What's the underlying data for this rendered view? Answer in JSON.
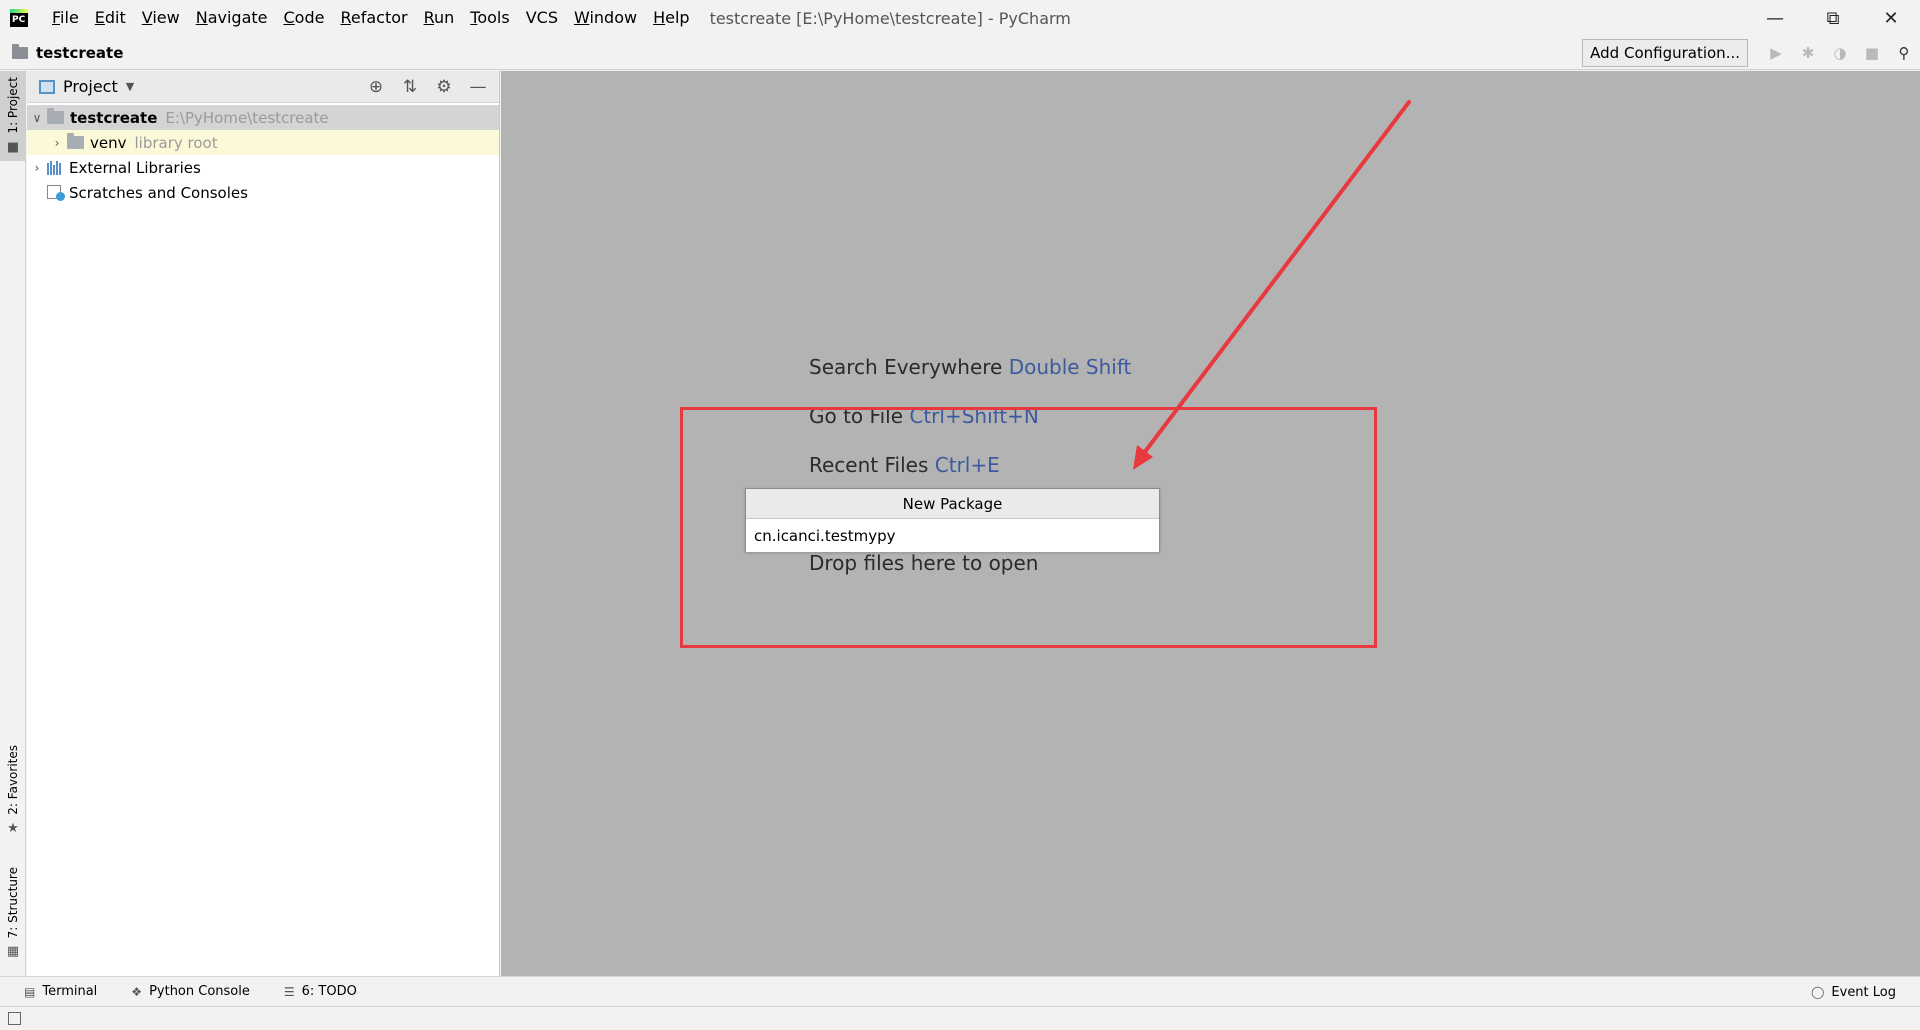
{
  "titlebar": {
    "menu": [
      {
        "mnemonic": "F",
        "rest": "ile"
      },
      {
        "mnemonic": "E",
        "rest": "dit"
      },
      {
        "mnemonic": "V",
        "rest": "iew"
      },
      {
        "mnemonic": "N",
        "rest": "avigate"
      },
      {
        "mnemonic": "C",
        "rest": "ode"
      },
      {
        "mnemonic": "R",
        "rest": "efactor"
      },
      {
        "mnemonic": "R",
        "rest": "un"
      },
      {
        "mnemonic": "T",
        "rest": "ools"
      },
      {
        "mnemonic": "",
        "rest": "VCS"
      },
      {
        "mnemonic": "W",
        "rest": "indow"
      },
      {
        "mnemonic": "H",
        "rest": "elp"
      }
    ],
    "window_title": "testcreate [E:\\PyHome\\testcreate] - PyCharm"
  },
  "navbar": {
    "project_name": "testcreate",
    "add_configuration": "Add Configuration..."
  },
  "left_stripe": {
    "project_tab": "1: Project",
    "favorites_tab": "2: Favorites",
    "structure_tab": "7: Structure"
  },
  "project_panel": {
    "title": "Project",
    "tree": {
      "root_name": "testcreate",
      "root_path": "E:\\PyHome\\testcreate",
      "venv_name": "venv",
      "venv_note": "library root",
      "external_libraries": "External Libraries",
      "scratches": "Scratches and Consoles"
    }
  },
  "editor": {
    "search_label": "Search Everywhere",
    "search_key": "Double Shift",
    "goto_label": "Go to File",
    "goto_key": "Ctrl+Shift+N",
    "recent_label": "Recent Files",
    "recent_key": "Ctrl+E",
    "drop_label": "Drop files here to open"
  },
  "popup": {
    "title": "New Package",
    "value": "cn.icanci.testmypy"
  },
  "bottom_bar": {
    "terminal": "Terminal",
    "python_console": "Python Console",
    "todo": "6: TODO",
    "event_log": "Event Log"
  },
  "colors": {
    "annotation_red": "#e8393e",
    "shortcut_blue": "#3d5a9e",
    "editor_background": "#b3b3b3"
  }
}
